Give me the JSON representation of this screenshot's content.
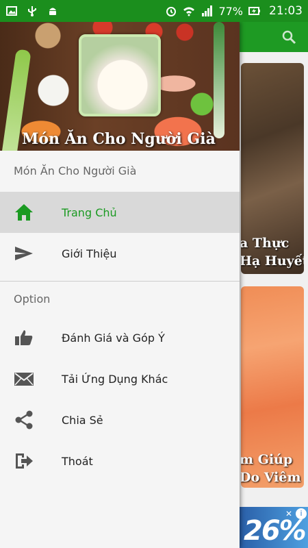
{
  "status_bar": {
    "battery": "77%",
    "time": "21:03"
  },
  "drawer": {
    "header_title": "Món Ăn Cho Người Già",
    "subtitle": "Món Ăn Cho Người Già",
    "primary_items": [
      {
        "label": "Trang Chủ",
        "icon": "home-icon",
        "active": true
      },
      {
        "label": "Giới Thiệu",
        "icon": "send-icon",
        "active": false
      }
    ],
    "section_label": "Option",
    "option_items": [
      {
        "label": "Đánh Giá và Góp Ý",
        "icon": "thumbs-up-icon"
      },
      {
        "label": "Tải Ứng Dụng Khác",
        "icon": "mail-icon"
      },
      {
        "label": "Chia Sẻ",
        "icon": "share-icon"
      },
      {
        "label": "Thoát",
        "icon": "exit-icon"
      }
    ]
  },
  "background": {
    "cards": [
      {
        "title_line1": "a Thực",
        "title_line2": "Hạ Huyết"
      },
      {
        "title_line1": "m Giúp",
        "title_line2": "Do Viêm"
      }
    ],
    "ad_text": "26%"
  },
  "colors": {
    "accent": "#1b9a22",
    "status_bar": "#1b8e1d"
  }
}
